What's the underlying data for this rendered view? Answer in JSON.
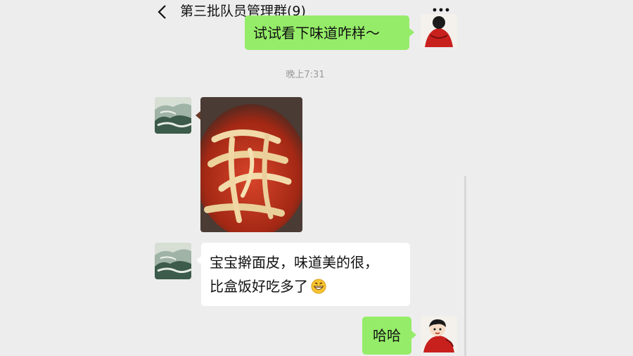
{
  "header": {
    "title": "第三批队员管理群(9)",
    "back_icon": "chevron-left-icon",
    "more_icon": "more-dots-icon"
  },
  "messages": [
    {
      "direction": "out",
      "text": "试试看下味道咋样～"
    },
    {
      "type": "timestamp",
      "text": "晚上7:31"
    },
    {
      "direction": "in",
      "type": "image",
      "description_icon": "food-photo"
    },
    {
      "direction": "in",
      "line1": "宝宝擀面皮，味道美的很，",
      "line2": "比盒饭好吃多了",
      "emoji": "grinning-face-icon"
    },
    {
      "direction": "out",
      "text": "哈哈"
    }
  ],
  "colors": {
    "background": "#ededed",
    "outgoing_bubble": "#95ec69",
    "incoming_bubble": "#ffffff",
    "timestamp_text": "#9a9a9a"
  }
}
